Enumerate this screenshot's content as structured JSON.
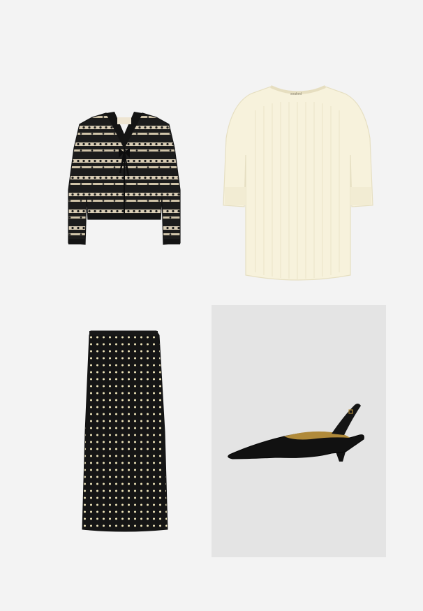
{
  "page": {
    "background": "#f3f3f3"
  },
  "items": [
    {
      "id": "cardigan",
      "kind": "cardigan",
      "colors": [
        "#1c1c1c",
        "#d8ccb4"
      ]
    },
    {
      "id": "tee",
      "kind": "knit-top",
      "colors": [
        "#f7f2dc"
      ],
      "label_text": "soaked"
    },
    {
      "id": "skirt",
      "kind": "polka-dot-skirt",
      "colors": [
        "#151515",
        "#ede3b8"
      ]
    },
    {
      "id": "shoe",
      "kind": "slingback-pump",
      "colors": [
        "#111111",
        "#b08a3a"
      ],
      "panel_color": "#e4e4e4"
    }
  ]
}
